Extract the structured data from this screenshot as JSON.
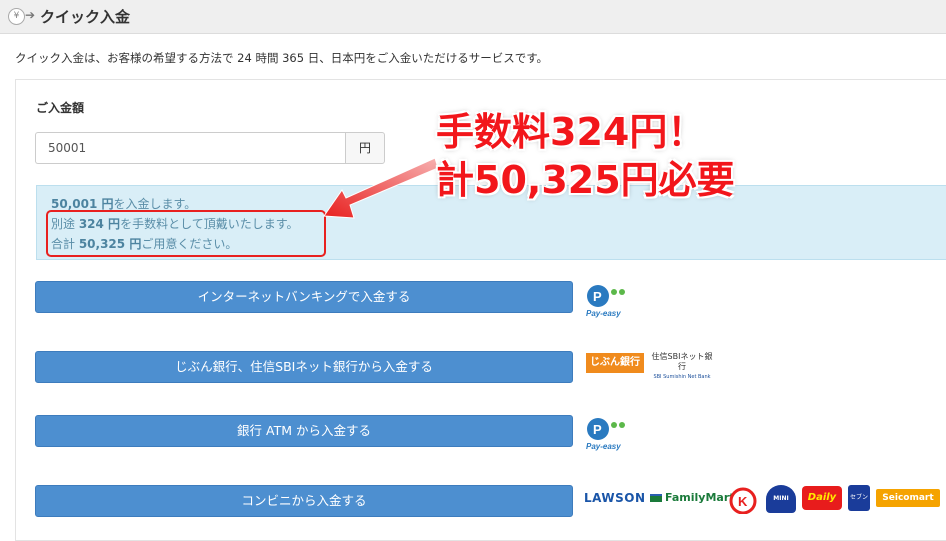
{
  "header": {
    "title": "クイック入金",
    "yen_symbol": "¥"
  },
  "description": "クイック入金は、お客様の希望する方法で 24 時間 365 日、日本円をご入金いただけるサービスです。",
  "amount": {
    "label": "ご入金額",
    "value": "50001",
    "unit": "円"
  },
  "info": {
    "line1_amount": "50,001 円",
    "line1_text": "を入金します。",
    "line2_prefix": "別途 ",
    "line2_amount": "324 円",
    "line2_text": "を手数料として頂戴いたします。",
    "line3_prefix": "合計 ",
    "line3_amount": "50,325 円",
    "line3_text": "ご用意ください。"
  },
  "callout": {
    "line1": "手数料324円！",
    "line2": "計50,325円必要",
    "color": "#f2161b"
  },
  "buttons": {
    "internet_banking": "インターネットバンキングで入金する",
    "jibun_sbi": "じぶん銀行、住信SBIネット銀行から入金する",
    "atm": "銀行 ATM から入金する",
    "konbini": "コンビニから入金する"
  },
  "logos": {
    "payeasy": "Pay-easy",
    "jibun": "じぶん銀行",
    "sbi": "住信SBIネット銀行",
    "sbi_sub": "SBI Sumishin Net Bank",
    "lawson": "LAWSON",
    "familymart": "FamilyMart",
    "circlek": "K",
    "ministop": "MINI STOP",
    "daily": "Daily",
    "seven": "セブン",
    "seicomart": "Seicomart"
  },
  "colors": {
    "accent_button": "#4d8fd0",
    "info_bg": "#d9eef7",
    "highlight": "#e8201f"
  }
}
